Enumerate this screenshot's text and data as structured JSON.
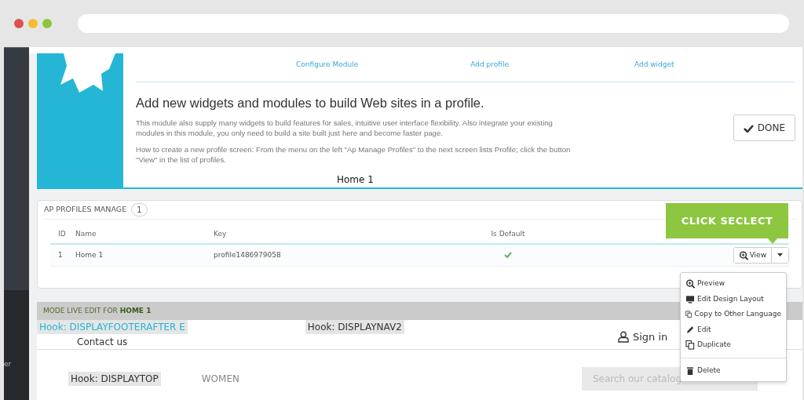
{
  "browser": {
    "dots": [
      {
        "color": "#e0504d"
      },
      {
        "color": "#f5bd2f"
      },
      {
        "color": "#8dc63f"
      }
    ]
  },
  "sidebar": {
    "items": [
      "er"
    ]
  },
  "module": {
    "links": [
      "Configure Module",
      "Add profile",
      "Add widget"
    ],
    "title": "Add new widgets and modules to build Web sites in a profile.",
    "paragraphs": [
      "This module also supply many widgets to build features for sales, intuitive user interface flexibility. Also integrate your existing modules in this module, you only need to build a site built just here and become faster page.",
      "How to create a new profile screen: From the menu on the left \"Ap Manage Profiles\" to the next screen lists Profile; click the button \"View\" in the list of profiles."
    ],
    "overlay_label": "Home 1",
    "done_button": "DONE"
  },
  "profiles": {
    "title": "AP PROFILES MANAGE",
    "count": "1",
    "columns": [
      "ID",
      "Name",
      "Key",
      "Is Default"
    ],
    "rows": [
      {
        "id": "1",
        "name": "Home 1",
        "key": "profile1486979058",
        "is_default": true,
        "action": "View"
      }
    ],
    "callout": "CLICK SECLECT",
    "menu": [
      {
        "label": "Preview",
        "kind": "zoom"
      },
      {
        "label": "Edit Design Layout",
        "kind": "monitor"
      },
      {
        "label": "Copy to Other Language",
        "kind": "copy"
      },
      {
        "label": "Edit",
        "kind": "pencil"
      },
      {
        "label": "Duplicate",
        "kind": "copy"
      },
      {
        "label": "Delete",
        "kind": "trash",
        "divider_before": true
      }
    ]
  },
  "live_edit": {
    "bar": "MODE LIVE EDIT FOR **HOME 1**",
    "hook_footer": "Hook: DISPLAYFOOTERAFTER E",
    "hook_nav": "Hook: DISPLAYNAV2",
    "contact": "Contact us",
    "sign_in": "Sign in",
    "hook_top": "Hook: DISPLAYTOP",
    "menu_item": "WOMEN",
    "search": {
      "placeholder": "Search our catalog"
    }
  }
}
